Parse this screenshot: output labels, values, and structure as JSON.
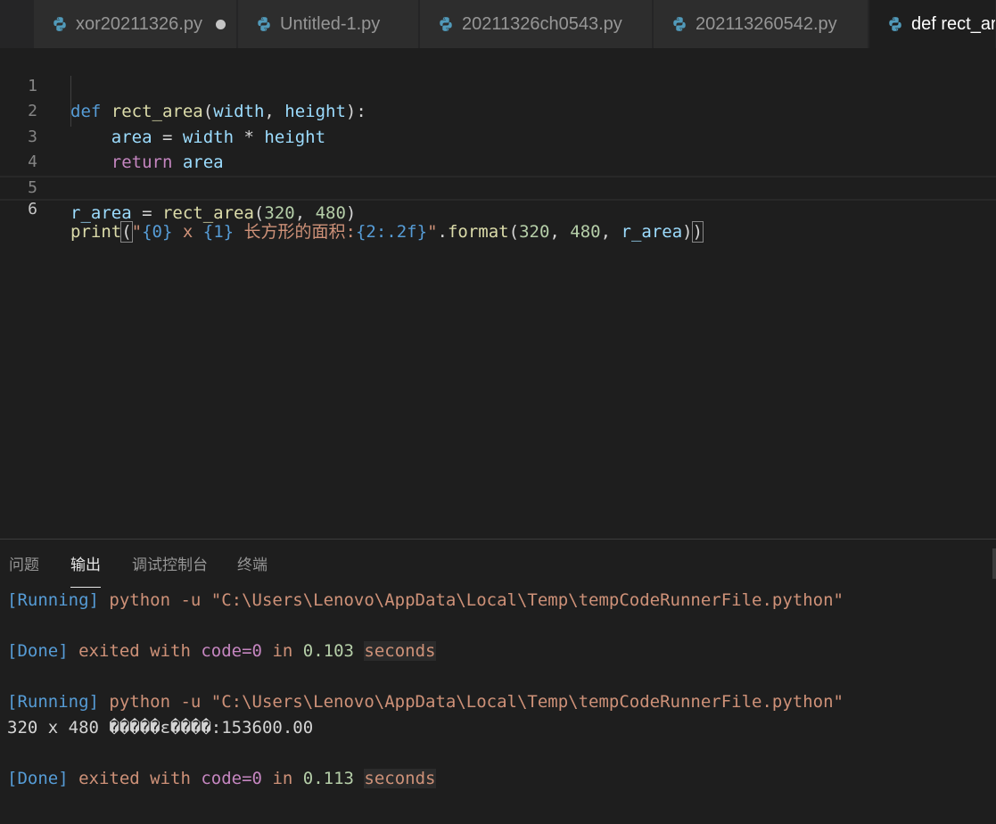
{
  "tabs": [
    {
      "label": "xor20211326.py",
      "dirty": true
    },
    {
      "label": "Untitled-1.py"
    },
    {
      "label": "20211326ch0543.py"
    },
    {
      "label": "202113260542.py"
    },
    {
      "label": "def rect_area",
      "active": true
    }
  ],
  "editor": {
    "line_numbers": [
      "1",
      "2",
      "3",
      "4",
      "5",
      "6"
    ],
    "current_line": "6",
    "lines": {
      "l1": {
        "kw": "def",
        "fn": "rect_area",
        "p1": "(",
        "a1": "width",
        "c1": ", ",
        "a2": "height",
        "p2": "):"
      },
      "l2": {
        "indent": "    ",
        "v1": "area",
        "op": " = ",
        "v2": "width",
        "op2": " * ",
        "v3": "height"
      },
      "l3": {
        "indent": "    ",
        "kw": "return",
        "sp": " ",
        "v": "area"
      },
      "l5": {
        "v": "r_area",
        "op": " = ",
        "fn": "rect_area",
        "p1": "(",
        "n1": "320",
        "c": ", ",
        "n2": "480",
        "p2": ")"
      },
      "l6": {
        "fn": "print",
        "p1": "(",
        "q1": "\"",
        "f0": "{0}",
        "s1": " x ",
        "f1": "{1}",
        "s2": " 长方形的面积:",
        "f2": "{2:.2f}",
        "q2": "\"",
        "dot": ".",
        "fmt": "format",
        "p3": "(",
        "n1": "320",
        "c1": ", ",
        "n2": "480",
        "c2": ", ",
        "v": "r_area",
        "p4": ")",
        "p5": ")"
      }
    }
  },
  "panel": {
    "tabs": [
      {
        "label": "问题"
      },
      {
        "label": "输出",
        "active": true
      },
      {
        "label": "调试控制台"
      },
      {
        "label": "终端"
      }
    ],
    "output": {
      "run1": {
        "tag": "[Running]",
        "cmd": " python -u \"C:\\Users\\Lenovo\\AppData\\Local\\Temp\\tempCodeRunnerFile.python\""
      },
      "done1": {
        "tag": "[Done]",
        "w1": " exited with ",
        "code": "code=0",
        "w2": " in ",
        "time": "0.103",
        "sp": " ",
        "sec": "seconds"
      },
      "run2": {
        "tag": "[Running]",
        "cmd": " python -u \"C:\\Users\\Lenovo\\AppData\\Local\\Temp\\tempCodeRunnerFile.python\""
      },
      "result": "320 x 480 �����ε����:153600.00",
      "done2": {
        "tag": "[Done]",
        "w1": " exited with ",
        "code": "code=0",
        "w2": " in ",
        "time": "0.113",
        "sp": " ",
        "sec": "seconds"
      }
    }
  },
  "colors": {
    "editor_bg": "#1e1e1e",
    "tab_bg": "#2d2d2d",
    "keyword": "#569cd6",
    "string": "#ce9178",
    "function": "#dcdcaa",
    "variable": "#9cdcfe",
    "number": "#b5cea8"
  },
  "icons": {
    "tab_file_icon": "python-icon"
  }
}
